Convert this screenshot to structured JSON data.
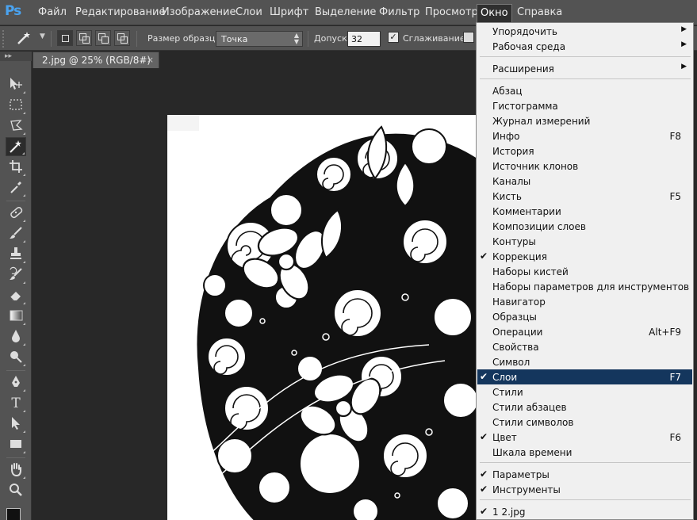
{
  "app": {
    "logo": "Ps"
  },
  "menubar": {
    "items": [
      "Файл",
      "Редактирование",
      "Изображение",
      "Слои",
      "Шрифт",
      "Выделение",
      "Фильтр",
      "Просмотр",
      "Окно",
      "Справка"
    ],
    "active": "Окно"
  },
  "options": {
    "tool_icon": "magic-wand-icon",
    "sample_size_label": "Размер образца:",
    "sample_size_value": "Точка",
    "tolerance_label": "Допуск:",
    "tolerance_value": "32",
    "antialias_label": "Сглаживание",
    "antialias_checked": true
  },
  "document": {
    "tab_title": "2.jpg @ 25% (RGB/8#)",
    "close_glyph": "×"
  },
  "toolbar": {
    "header": "▸▸",
    "tools": [
      "move-tool-icon",
      "marquee-tool-icon",
      "lasso-tool-icon",
      "magic-wand-tool-icon",
      "crop-tool-icon",
      "eyedropper-tool-icon",
      "healing-brush-tool-icon",
      "brush-tool-icon",
      "clone-stamp-tool-icon",
      "history-brush-tool-icon",
      "eraser-tool-icon",
      "gradient-tool-icon",
      "blur-tool-icon",
      "dodge-tool-icon",
      "pen-tool-icon",
      "type-tool-icon",
      "path-selection-tool-icon",
      "shape-tool-icon",
      "hand-tool-icon",
      "zoom-tool-icon"
    ],
    "selected": "magic-wand-tool-icon"
  },
  "mini_panel": {
    "header": "▸▸",
    "close": "×"
  },
  "window_menu": {
    "groups": [
      [
        {
          "label": "Упорядочить",
          "submenu": true
        },
        {
          "label": "Рабочая среда",
          "submenu": true
        }
      ],
      [
        {
          "label": "Расширения",
          "submenu": true
        }
      ],
      [
        {
          "label": "Абзац"
        },
        {
          "label": "Гистограмма"
        },
        {
          "label": "Журнал измерений"
        },
        {
          "label": "Инфо",
          "shortcut": "F8"
        },
        {
          "label": "История"
        },
        {
          "label": "Источник клонов"
        },
        {
          "label": "Каналы"
        },
        {
          "label": "Кисть",
          "shortcut": "F5"
        },
        {
          "label": "Комментарии"
        },
        {
          "label": "Композиции слоев"
        },
        {
          "label": "Контуры"
        },
        {
          "label": "Коррекция",
          "checked": true
        },
        {
          "label": "Наборы кистей"
        },
        {
          "label": "Наборы параметров для инструментов"
        },
        {
          "label": "Навигатор"
        },
        {
          "label": "Образцы"
        },
        {
          "label": "Операции",
          "shortcut": "Alt+F9"
        },
        {
          "label": "Свойства"
        },
        {
          "label": "Символ"
        },
        {
          "label": "Слои",
          "shortcut": "F7",
          "checked": true,
          "highlighted": true
        },
        {
          "label": "Стили"
        },
        {
          "label": "Стили абзацев"
        },
        {
          "label": "Стили символов"
        },
        {
          "label": "Цвет",
          "shortcut": "F6",
          "checked": true
        },
        {
          "label": "Шкала времени"
        }
      ],
      [
        {
          "label": "Параметры",
          "checked": true
        },
        {
          "label": "Инструменты",
          "checked": true
        }
      ],
      [
        {
          "label": "1 2.jpg",
          "checked": true
        }
      ]
    ]
  },
  "colors": {
    "menu_highlight": "#14365d",
    "chrome": "#535353",
    "canvas_bg": "#282828",
    "ps_blue": "#4aa3f0"
  }
}
